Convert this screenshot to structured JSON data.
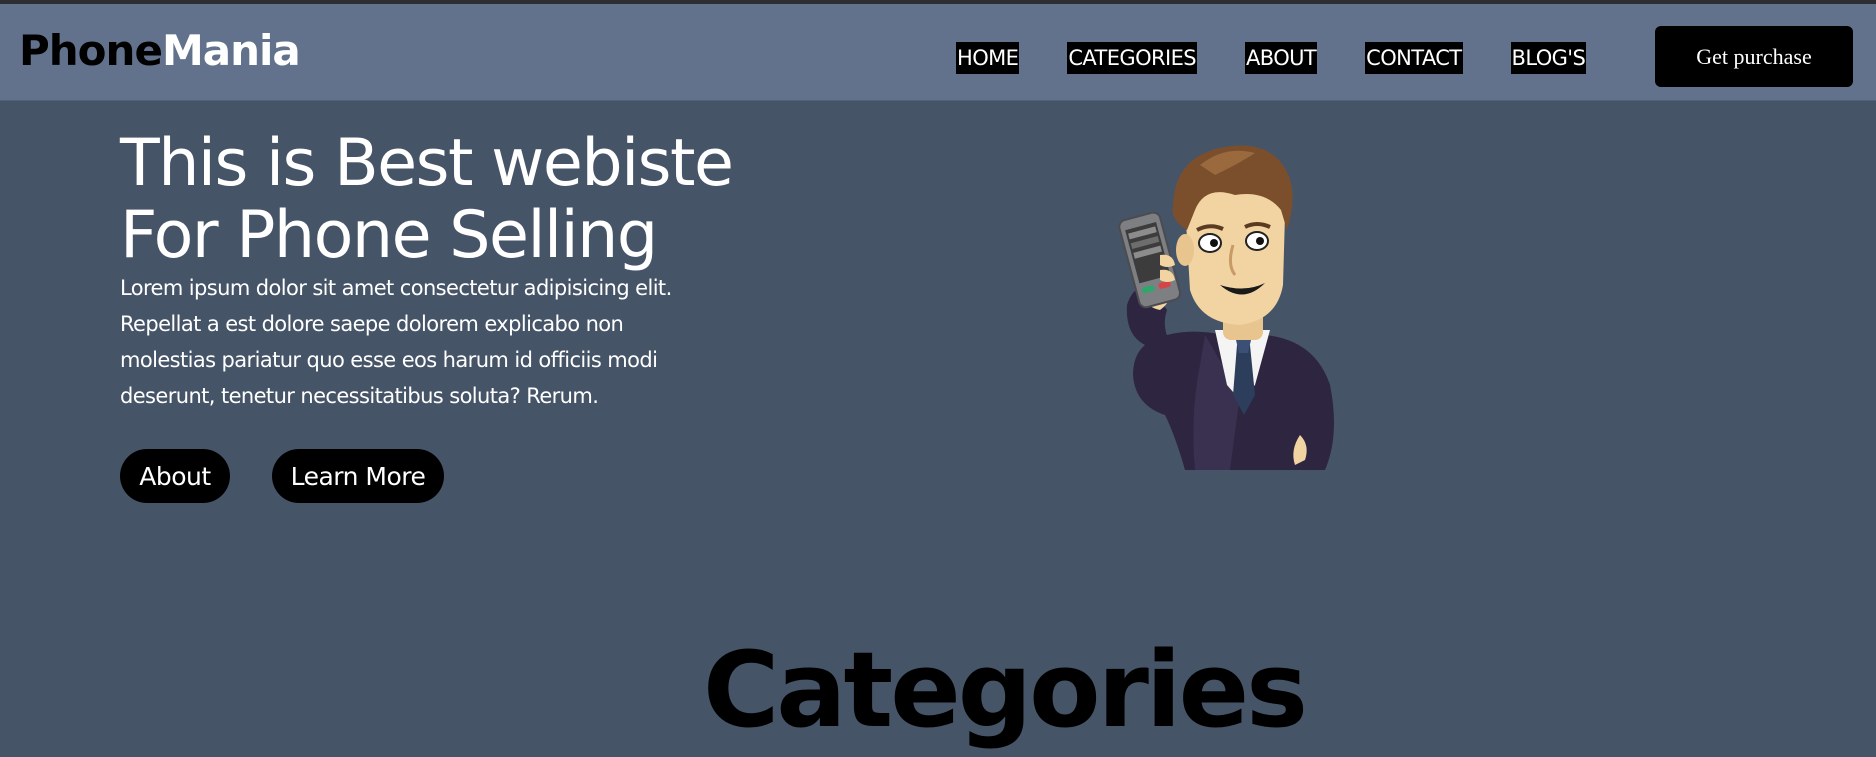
{
  "brand": {
    "part1": "Phone",
    "part2": "Mania"
  },
  "nav": {
    "items": [
      "HOME",
      "CATEGORIES",
      "ABOUT",
      "CONTACT",
      "BLOG'S"
    ],
    "cta": "Get purchase"
  },
  "hero": {
    "title_line1": "This is Best webiste",
    "title_line2": "For Phone Selling",
    "description": "Lorem ipsum dolor sit amet consectetur adipisicing elit. Repellat a est dolore saepe dolorem explicabo non molestias pariatur quo esse eos harum id officiis modi deserunt, tenetur necessitatibus soluta? Rerum.",
    "buttons": {
      "about": "About",
      "learn_more": "Learn More"
    }
  },
  "sections": {
    "categories_title": "Categories"
  },
  "colors": {
    "page_bg": "#465468",
    "header_bg": "#63728c",
    "button_bg": "#000000",
    "text_light": "#ffffff"
  }
}
